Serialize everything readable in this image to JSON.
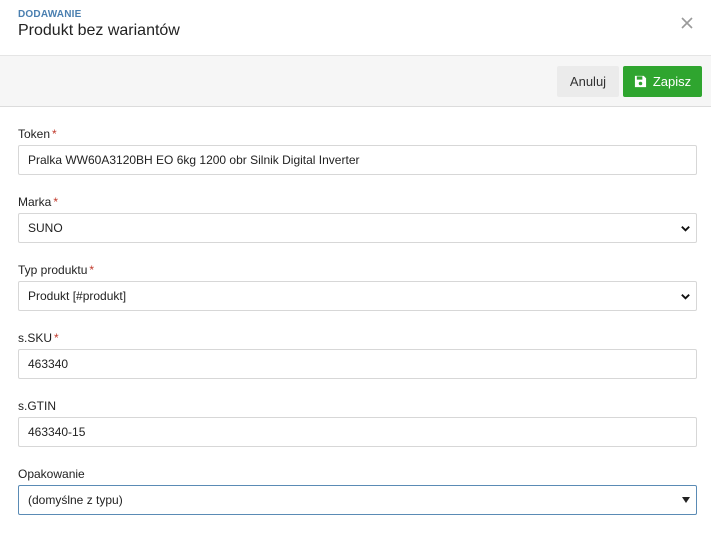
{
  "header": {
    "eyebrow": "DODAWANIE",
    "title": "Produkt bez wariantów"
  },
  "toolbar": {
    "cancel_label": "Anuluj",
    "save_label": "Zapisz",
    "save_color": "#2fa52f"
  },
  "form": {
    "required_mark": "*",
    "token": {
      "label": "Token",
      "value": "Pralka WW60A3120BH EO 6kg 1200 obr Silnik Digital Inverter"
    },
    "marka": {
      "label": "Marka",
      "value": "SUNO"
    },
    "typ": {
      "label": "Typ produktu",
      "value": "Produkt [#produkt]"
    },
    "sku": {
      "label": "s.SKU",
      "value": "463340"
    },
    "gtin": {
      "label": "s.GTIN",
      "value": "463340-15"
    },
    "opakowanie": {
      "label": "Opakowanie",
      "value": "(domyślne z typu)"
    }
  },
  "icons": {
    "close": "close-icon",
    "save": "floppy-disk-icon",
    "select": "chevron-down-icon",
    "caret": "caret-down-icon"
  }
}
